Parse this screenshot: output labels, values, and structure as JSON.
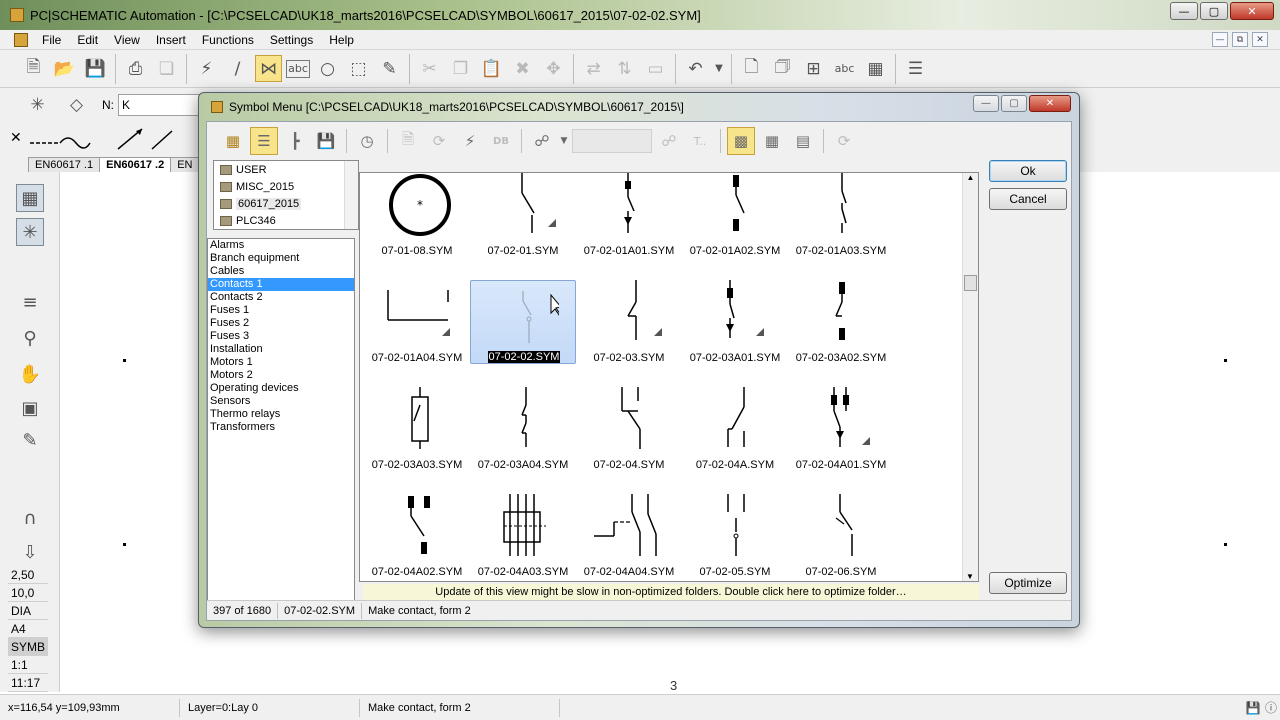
{
  "window": {
    "title": "PC|SCHEMATIC Automation - [C:\\PCSELCAD\\UK18_marts2016\\PCSELCAD\\SYMBOL\\60617_2015\\07-02-02.SYM]",
    "minimize_icon": "minimize-icon",
    "restore_icon": "restore-icon",
    "close_icon": "close-icon"
  },
  "menu": [
    "File",
    "Edit",
    "View",
    "Insert",
    "Functions",
    "Settings",
    "Help"
  ],
  "toolbar2": {
    "name_label": "N:",
    "name_value": "K"
  },
  "tabs": [
    "EN60617 .1",
    "EN60617 .2",
    "EN"
  ],
  "scales": [
    "2,50",
    "10,0",
    "DIA",
    "A4",
    "SYMB",
    "1:1",
    "11:17"
  ],
  "canvas": {
    "page_number": "3"
  },
  "statusbar": {
    "coords": "x=116,54 y=109,93mm",
    "layer": "Layer=0:Lay 0",
    "description": "Make contact, form 2"
  },
  "dialog": {
    "title": "Symbol Menu [C:\\PCSELCAD\\UK18_marts2016\\PCSELCAD\\SYMBOL\\60617_2015\\]",
    "folders": [
      "USER",
      "MISC_2015",
      "60617_2015",
      "PLC346"
    ],
    "current_folder": "60617_2015",
    "categories": [
      "Alarms",
      "Branch equipment",
      "Cables",
      "Contacts 1",
      "Contacts 2",
      "Fuses 1",
      "Fuses 2",
      "Fuses 3",
      "Installation",
      "Motors 1",
      "Motors 2",
      "Operating devices",
      "Sensors",
      "Thermo relays",
      "Transformers"
    ],
    "selected_category": "Contacts 1",
    "symbols": [
      "07-01-08.SYM",
      "07-02-01.SYM",
      "07-02-01A01.SYM",
      "07-02-01A02.SYM",
      "07-02-01A03.SYM",
      "07-02-01A04.SYM",
      "07-02-02.SYM",
      "07-02-03.SYM",
      "07-02-03A01.SYM",
      "07-02-03A02.SYM",
      "07-02-03A03.SYM",
      "07-02-03A04.SYM",
      "07-02-04.SYM",
      "07-02-04A.SYM",
      "07-02-04A01.SYM",
      "07-02-04A02.SYM",
      "07-02-04A03.SYM",
      "07-02-04A04.SYM",
      "07-02-05.SYM",
      "07-02-06.SYM"
    ],
    "selected_symbol": "07-02-02.SYM",
    "optimize_message": "Update of this view might be slow in non-optimized folders. Double click here to optimize folder…",
    "ok_label": "Ok",
    "cancel_label": "Cancel",
    "optimize_label": "Optimize",
    "status": {
      "count": "397 of 1680",
      "file": "07-02-02.SYM",
      "description": "Make contact, form 2"
    }
  }
}
